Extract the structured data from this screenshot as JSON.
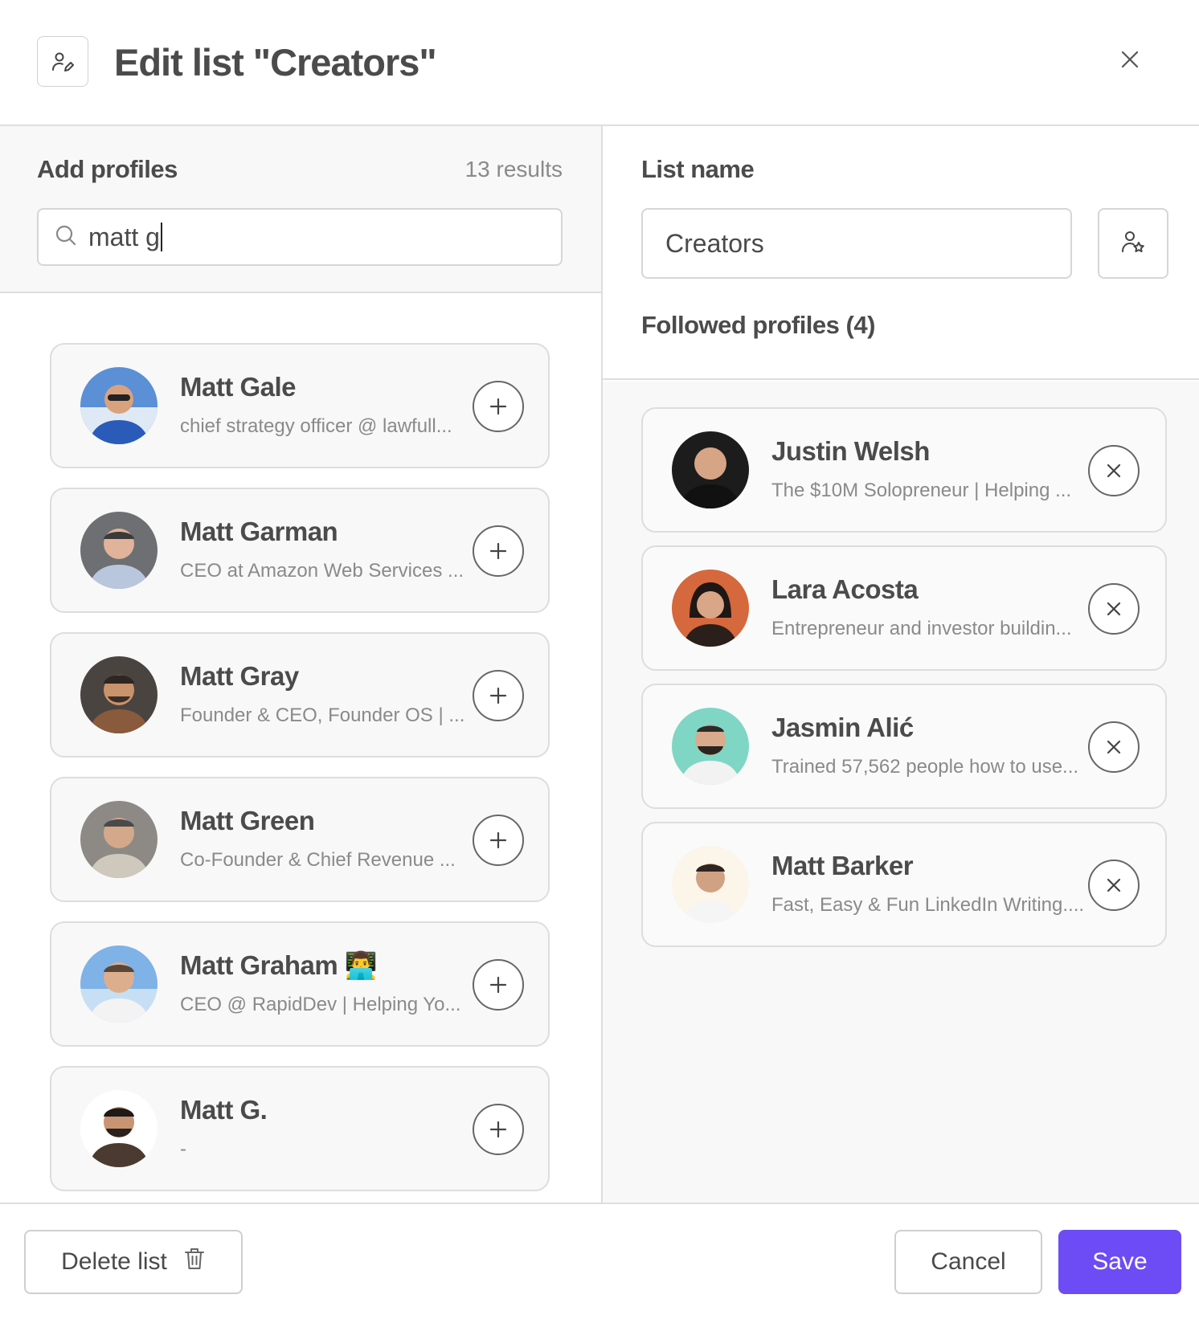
{
  "header": {
    "title": "Edit list \"Creators\""
  },
  "add_panel": {
    "label": "Add profiles",
    "results_count": "13 results",
    "search_value": "matt g",
    "profiles": [
      {
        "name": "Matt Gale",
        "description": "chief strategy officer @ lawfull..."
      },
      {
        "name": "Matt Garman",
        "description": "CEO at Amazon Web Services ..."
      },
      {
        "name": "Matt Gray",
        "description": "Founder & CEO, Founder OS | ..."
      },
      {
        "name": "Matt Green",
        "description": "Co-Founder & Chief Revenue ..."
      },
      {
        "name": "Matt Graham 👨‍💻",
        "description": "CEO @ RapidDev | Helping Yo..."
      },
      {
        "name": "Matt G.",
        "description": "-"
      }
    ]
  },
  "list_panel": {
    "label": "List name",
    "name_value": "Creators",
    "followed_label": "Followed profiles (4)",
    "followed": [
      {
        "name": "Justin Welsh",
        "description": "The $10M Solopreneur | Helping ..."
      },
      {
        "name": "Lara Acosta",
        "description": "Entrepreneur and investor buildin..."
      },
      {
        "name": "Jasmin Alić",
        "description": "Trained 57,562 people how to use..."
      },
      {
        "name": "Matt Barker",
        "description": "Fast, Easy & Fun LinkedIn Writing...."
      }
    ]
  },
  "footer": {
    "delete_label": "Delete list",
    "cancel_label": "Cancel",
    "save_label": "Save"
  },
  "colors": {
    "accent": "#6d4cf5",
    "border": "#dedede",
    "panel_bg": "#f8f8f8"
  }
}
